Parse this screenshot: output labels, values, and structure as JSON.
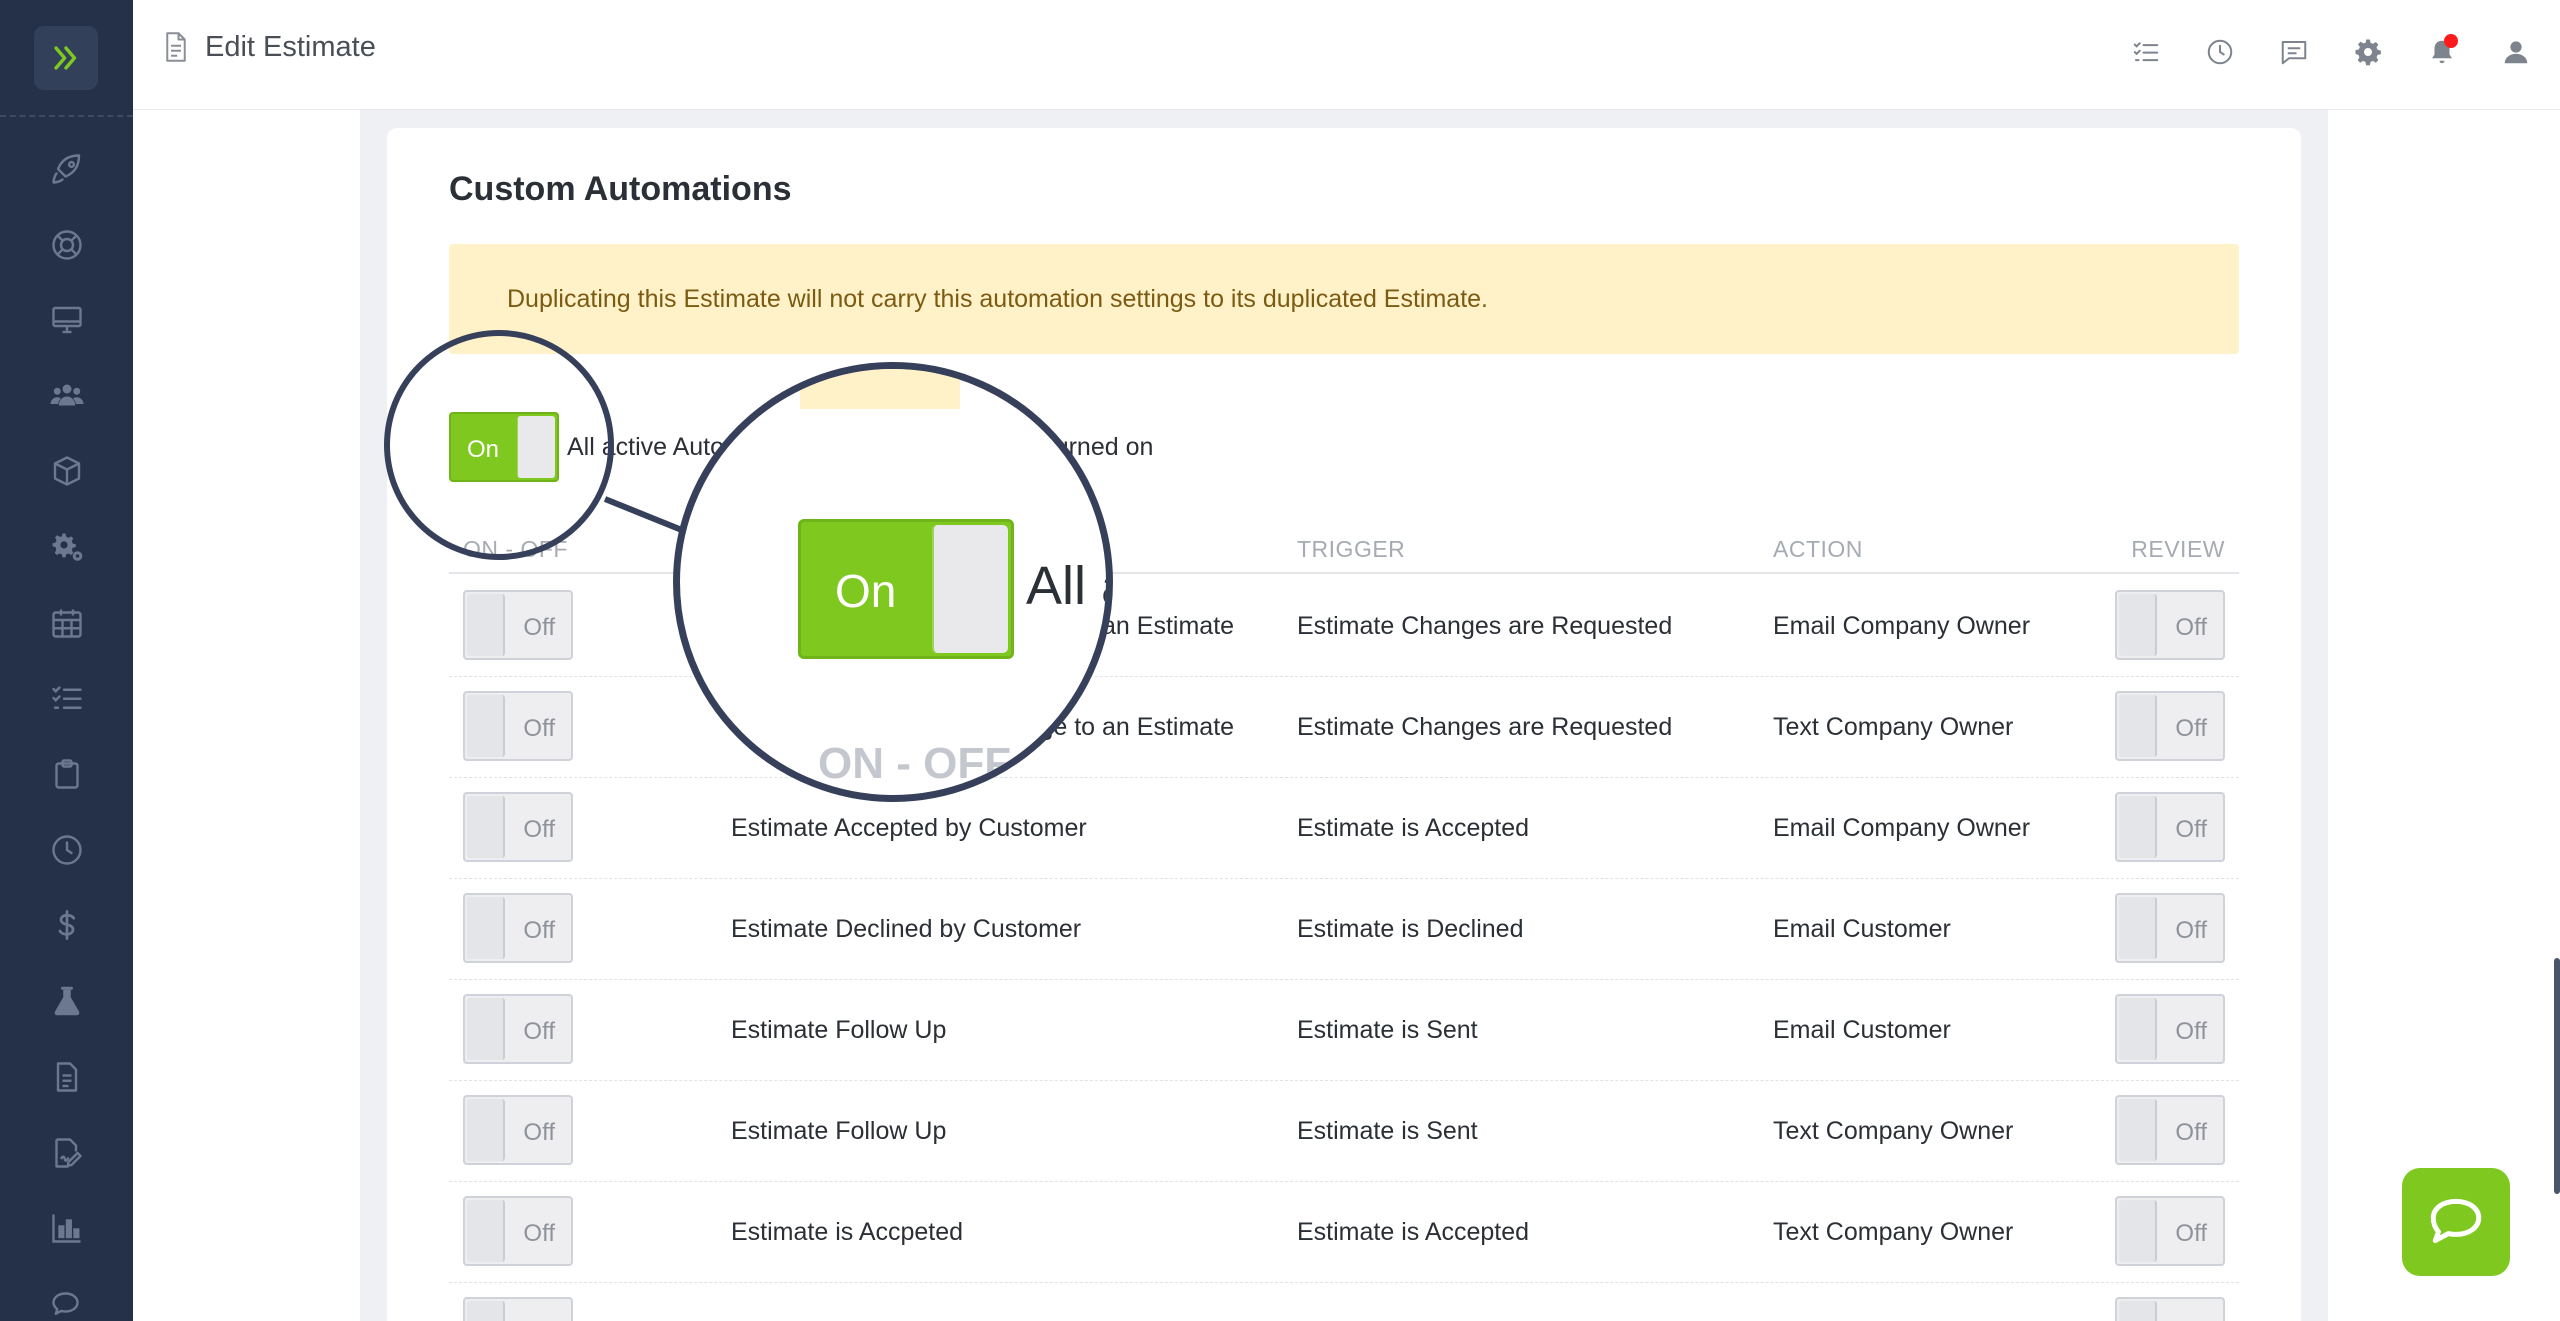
{
  "header": {
    "title": "Edit Estimate",
    "icons": [
      "checklist-icon",
      "clock-icon",
      "chat-icon",
      "gear-icon",
      "bell-icon",
      "user-icon"
    ],
    "notification_dot_color": "#ff1b1b"
  },
  "sidebar": {
    "items": [
      "rocket-icon",
      "lifebuoy-icon",
      "monitor-icon",
      "users-icon",
      "box-icon",
      "gears-icon",
      "calendar-icon",
      "list-check-icon",
      "clipboard-icon",
      "clock-icon",
      "dollar-icon",
      "flask-icon",
      "document-icon",
      "signature-icon",
      "bar-chart-icon",
      "chat-icon"
    ]
  },
  "card": {
    "title": "Custom Automations",
    "notice": "Duplicating this Estimate will not carry this automation settings to its duplicated Estimate.",
    "master_toggle_label": "On",
    "master_text": "All active Automations for this Estimate are turned on",
    "zoom_toggle_label": "On",
    "zoom_text": "All a",
    "zoom_header": "ON - OFF"
  },
  "table": {
    "headers": {
      "on_off": "ON - OFF",
      "trigger": "TRIGGER",
      "action": "ACTION",
      "review": "REVIEW"
    },
    "rows": [
      {
        "toggle": "Off",
        "name": "Customer Requests a Change to an Estimate",
        "trigger": "Estimate Changes are Requested",
        "action": "Email Company Owner",
        "review": "Off"
      },
      {
        "toggle": "Off",
        "name": "Customer Requests a Change to an Estimate",
        "trigger": "Estimate Changes are Requested",
        "action": "Text Company Owner",
        "review": "Off"
      },
      {
        "toggle": "Off",
        "name": "Estimate Accepted by Customer",
        "trigger": "Estimate is Accepted",
        "action": "Email Company Owner",
        "review": "Off"
      },
      {
        "toggle": "Off",
        "name": "Estimate Declined by Customer",
        "trigger": "Estimate is Declined",
        "action": "Email Customer",
        "review": "Off"
      },
      {
        "toggle": "Off",
        "name": "Estimate Follow Up",
        "trigger": "Estimate is Sent",
        "action": "Email Customer",
        "review": "Off"
      },
      {
        "toggle": "Off",
        "name": "Estimate Follow Up",
        "trigger": "Estimate is Sent",
        "action": "Text Company Owner",
        "review": "Off"
      },
      {
        "toggle": "Off",
        "name": "Estimate is Accpeted",
        "trigger": "Estimate is Accepted",
        "action": "Text Company Owner",
        "review": "Off"
      }
    ]
  },
  "colors": {
    "sidebar_bg": "#253148",
    "accent_green": "#7fc820",
    "notice_bg": "#fff2c8",
    "notice_text": "#7b5a12"
  }
}
